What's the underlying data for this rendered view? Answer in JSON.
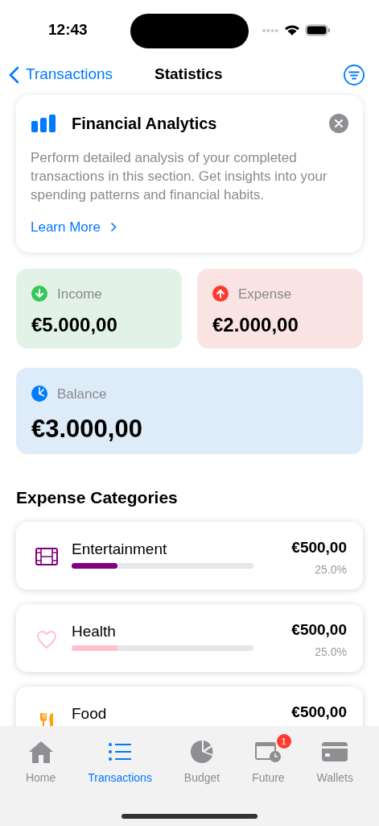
{
  "status_bar": {
    "time": "12:43"
  },
  "nav": {
    "back": "Transactions",
    "title": "Statistics"
  },
  "info_card": {
    "title": "Financial Analytics",
    "text": "Perform detailed analysis of your completed transactions in this section. Get insights into your spending patterns and financial habits.",
    "link": "Learn More"
  },
  "summary": [
    {
      "kind": "income",
      "label": "Income",
      "amount": "€5.000,00"
    },
    {
      "kind": "expense",
      "label": "Expense",
      "amount": "€2.000,00"
    },
    {
      "kind": "balance",
      "label": "Balance",
      "amount": "€3.000,00"
    }
  ],
  "categories_heading": "Expense Categories",
  "categories": [
    {
      "kind": "film",
      "name": "Entertainment",
      "amount": "€500,00",
      "percent": "25.0%",
      "level": 0.25,
      "color": "#800080"
    },
    {
      "kind": "heart",
      "name": "Health",
      "amount": "€500,00",
      "percent": "25.0%",
      "level": 0.25,
      "color": "#ffc0cb"
    },
    {
      "kind": "fork",
      "name": "Food",
      "amount": "€500,00",
      "color": "#ff9f0a"
    }
  ],
  "tab_bar": [
    {
      "kind": "home",
      "label": "Home",
      "selected": false
    },
    {
      "kind": "list",
      "label": "Transactions",
      "selected": true
    },
    {
      "kind": "pie",
      "label": "Budget",
      "selected": false
    },
    {
      "kind": "calendar",
      "label": "Future",
      "selected": false,
      "badge": "1"
    },
    {
      "kind": "card",
      "label": "Wallets",
      "selected": false
    }
  ]
}
